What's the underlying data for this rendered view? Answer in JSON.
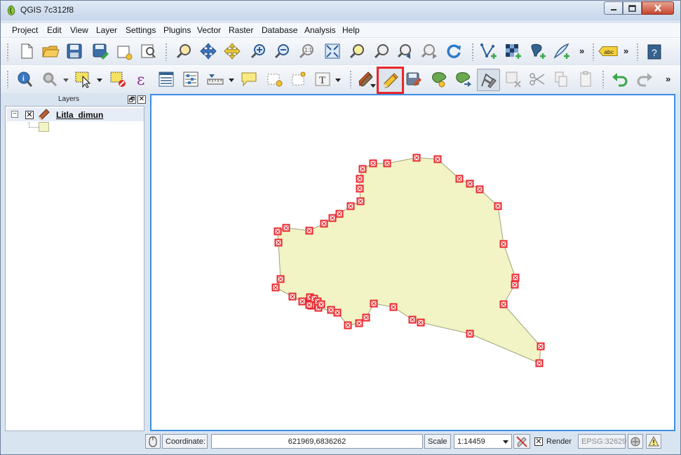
{
  "window": {
    "title": "QGIS 7c312f8",
    "icons": {
      "app": "qgis-logo-icon",
      "minimize": "minimize-icon",
      "maximize": "maximize-icon",
      "close": "close-icon"
    }
  },
  "menubar": {
    "items": [
      "Project",
      "Edit",
      "View",
      "Layer",
      "Settings",
      "Plugins",
      "Vector",
      "Raster",
      "Database",
      "Analysis",
      "Help"
    ]
  },
  "toolbar1": {
    "buttons": [
      "new-project-icon",
      "open-project-icon",
      "save-project-icon",
      "save-as-icon",
      "new-print-composer-icon",
      "composer-manager-icon",
      "pan-icon",
      "pan-to-selection-icon",
      "zoom-in-icon",
      "zoom-out-icon",
      "zoom-actual-size-icon",
      "zoom-full-icon",
      "zoom-to-selection-icon",
      "zoom-to-layer-icon",
      "zoom-last-icon",
      "zoom-next-icon",
      "refresh-icon",
      "add-vector-layer-icon",
      "add-raster-layer-icon",
      "add-postgis-layer-icon",
      "add-spatialite-layer-icon",
      "label-icon",
      "help-icon"
    ],
    "label_tool_text": "abc",
    "help_text": "?",
    "more": "»"
  },
  "toolbar2": {
    "buttons": [
      "identify-icon",
      "run-action-icon",
      "select-features-icon",
      "deselect-icon",
      "field-calculator-icon",
      "attribute-table-icon",
      "measure-icon",
      "annotation-icon",
      "text-annotation-icon",
      "current-edits-icon",
      "toggle-editing-icon",
      "save-edits-icon",
      "add-feature-icon",
      "move-feature-icon",
      "node-tool-icon",
      "delete-selected-icon",
      "cut-features-icon",
      "copy-features-icon",
      "paste-features-icon",
      "undo-icon",
      "redo-icon"
    ],
    "more": "»",
    "highlight_color": "#e8262b"
  },
  "layers_panel": {
    "title": "Layers",
    "undock": "🗗",
    "close": "✕",
    "layer": {
      "name": "Litla_dimun",
      "visible": true,
      "expanded": true,
      "fill_color": "#f2f4c5"
    }
  },
  "map": {
    "polygon_fill": "#f2f4c5",
    "polygon_stroke": "#9da37a",
    "vertex_color": "#e8262b"
  },
  "statusbar": {
    "coordinate_label": "Coordinate:",
    "coordinate_value": "621969,6836262",
    "scale_label": "Scale",
    "scale_value": "1:14459",
    "render_label": "Render",
    "render_checked": true,
    "crs_value": "EPSG:32629"
  }
}
